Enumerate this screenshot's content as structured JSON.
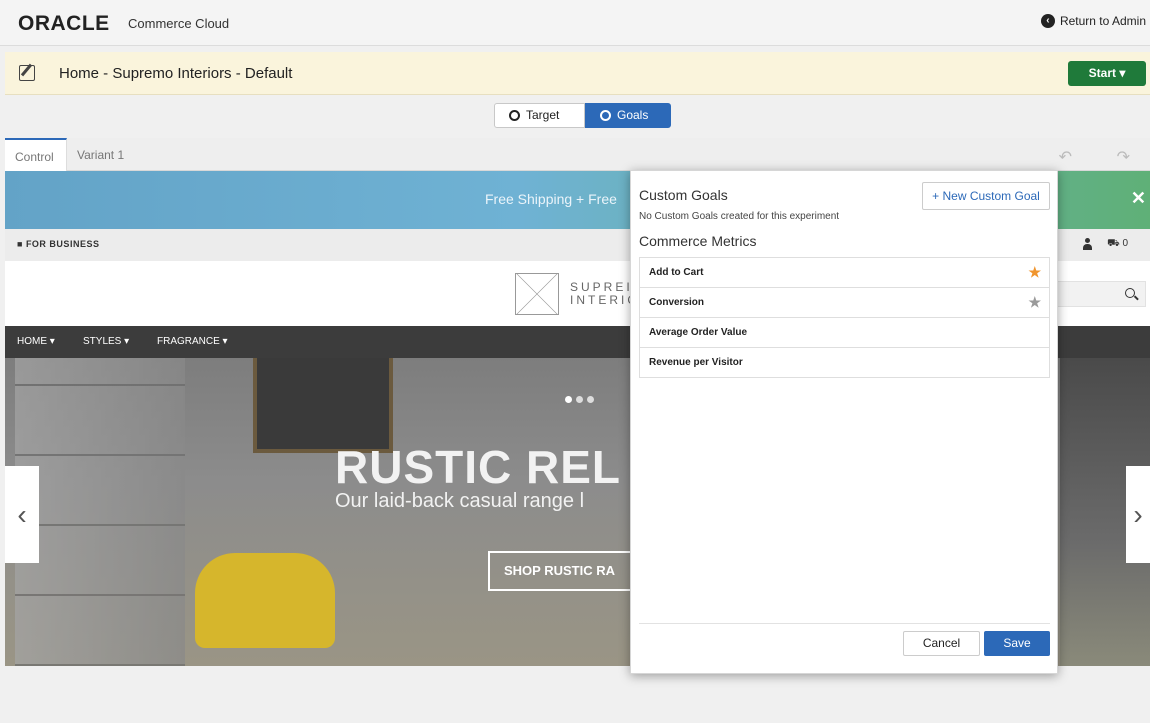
{
  "header": {
    "logo": "ORACLE",
    "product": "Commerce Cloud",
    "return_label": "Return to Admin"
  },
  "experiment": {
    "title": "Home - Supremo Interiors - Default",
    "start_label": "Start ▾"
  },
  "mode_toggle": {
    "target_label": "Target",
    "goals_label": "Goals",
    "active": "goals"
  },
  "variant_tabs": [
    {
      "label": "Control",
      "active": true
    },
    {
      "label": "Variant 1",
      "active": false
    }
  ],
  "site_preview": {
    "promo_text": "Free Shipping + Free",
    "business_label": "FOR BUSINESS",
    "cart_count": "0",
    "logo_text_line1": "SUPREI",
    "logo_text_line2": "INTERIC",
    "nav": [
      "HOME ▾",
      "STYLES ▾",
      "FRAGRANCE ▾"
    ],
    "hero_title": "RUSTIC REL",
    "hero_subtitle": "Our laid-back casual range l",
    "hero_button": "SHOP RUSTIC RA"
  },
  "goals_panel": {
    "custom_title": "Custom Goals",
    "custom_empty": "No Custom Goals created for this experiment",
    "new_goal_label": "+ New Custom Goal",
    "metrics_title": "Commerce Metrics",
    "metrics": [
      {
        "label": "Add to Cart",
        "star": "primary"
      },
      {
        "label": "Conversion",
        "star": "secondary"
      },
      {
        "label": "Average Order Value",
        "star": "none"
      },
      {
        "label": "Revenue per Visitor",
        "star": "none"
      }
    ],
    "cancel_label": "Cancel",
    "save_label": "Save"
  },
  "colors": {
    "accent": "#2c69b8",
    "start_button": "#1f7a3a",
    "star_primary": "#f0952e",
    "star_secondary": "#9a9a9a"
  }
}
